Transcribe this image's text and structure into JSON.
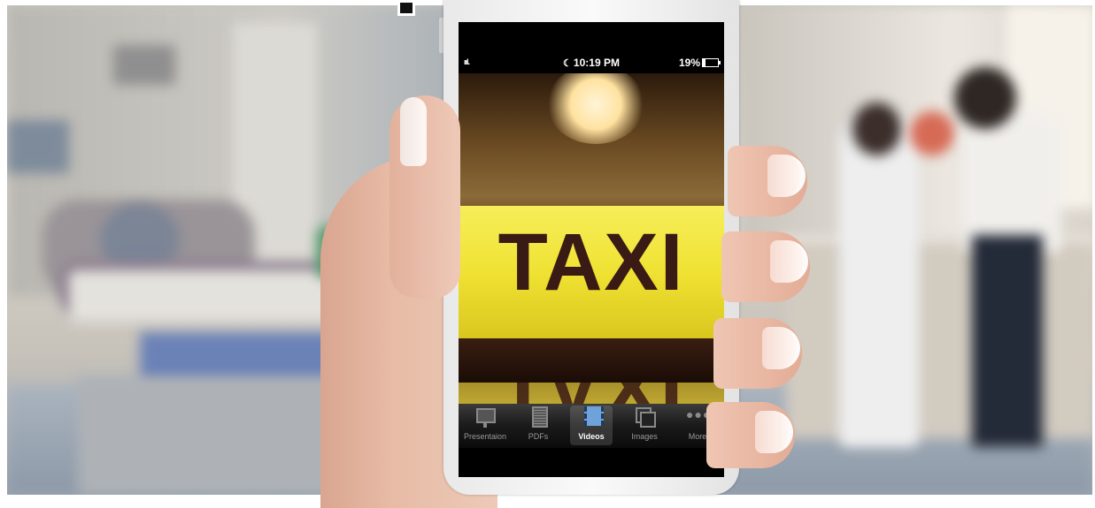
{
  "status_bar": {
    "signal": "ııl.",
    "time": "10:19 PM",
    "battery_percent": "19%",
    "battery_level": 0.19
  },
  "content": {
    "sign_text": "TAXI",
    "reflection_text": "TAXI"
  },
  "tab_bar": {
    "active_tab": "Videos",
    "active_color": "#6fa2d8",
    "tabs": [
      {
        "label": "Presentaion",
        "icon": "easel-icon"
      },
      {
        "label": "PDFs",
        "icon": "document-icon"
      },
      {
        "label": "Videos",
        "icon": "film-icon"
      },
      {
        "label": "Images",
        "icon": "images-icon"
      },
      {
        "label": "More",
        "icon": "more-icon",
        "glyph": "●●●"
      }
    ]
  }
}
